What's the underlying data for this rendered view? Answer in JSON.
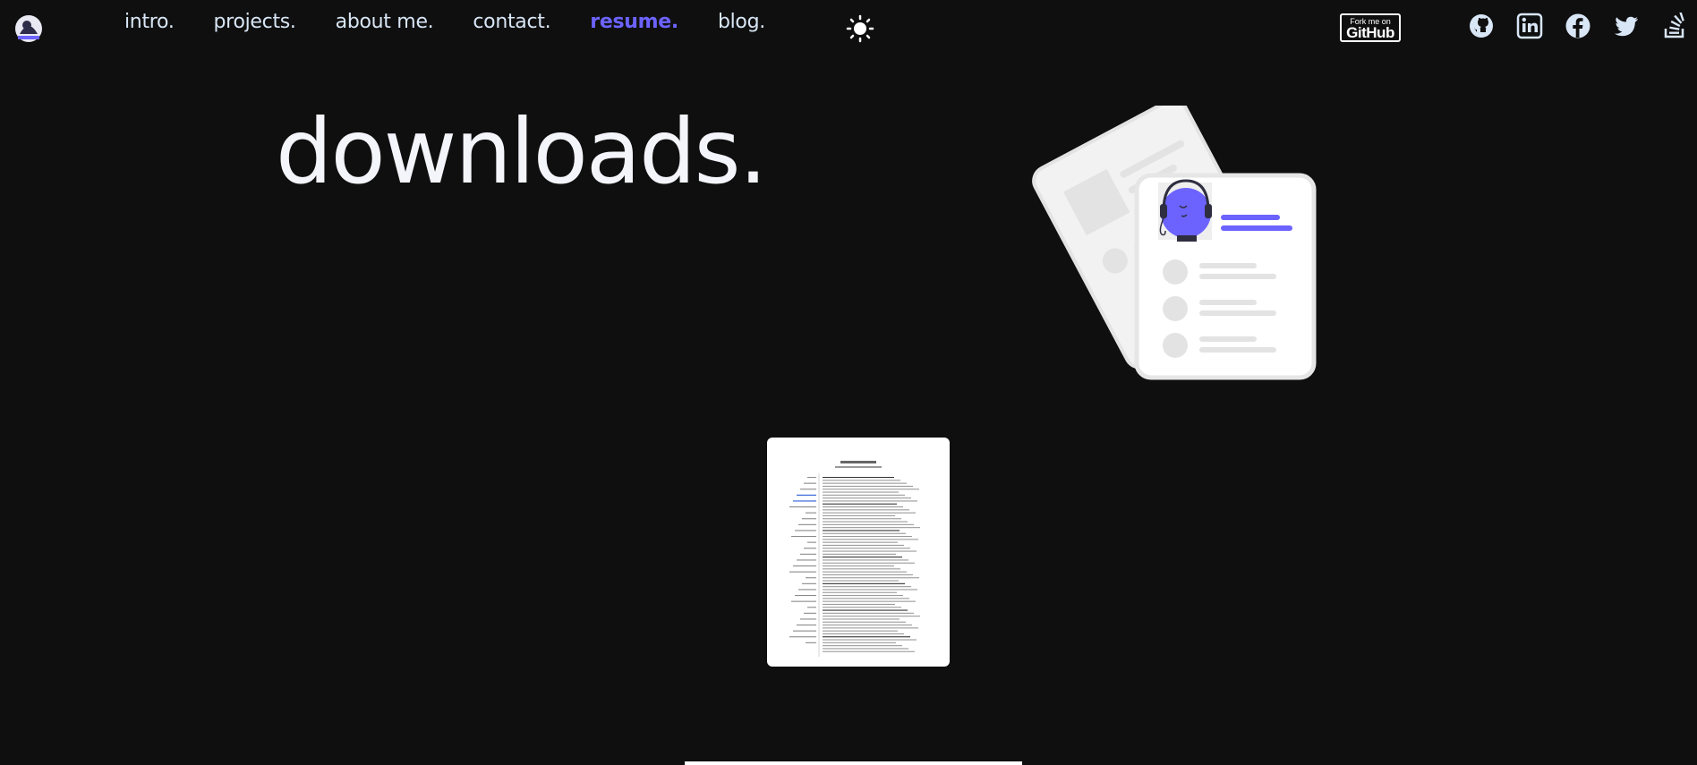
{
  "nav": {
    "links": [
      {
        "label": "intro."
      },
      {
        "label": "projects."
      },
      {
        "label": "about me."
      },
      {
        "label": "contact."
      },
      {
        "label": "resume."
      },
      {
        "label": "blog."
      }
    ],
    "active": "resume.",
    "theme_toggle_icon": "sun-icon"
  },
  "fork_badge": {
    "top": "Fork me on",
    "bottom": "GitHub"
  },
  "socials": [
    "github-icon",
    "linkedin-icon",
    "facebook-icon",
    "twitter-icon",
    "stackoverflow-icon"
  ],
  "main": {
    "heading": "downloads."
  },
  "colors": {
    "background": "#0f0f0f",
    "accent": "#6c63ff",
    "nav_text": "#d8e6f6",
    "heading": "#f4f4fb"
  }
}
